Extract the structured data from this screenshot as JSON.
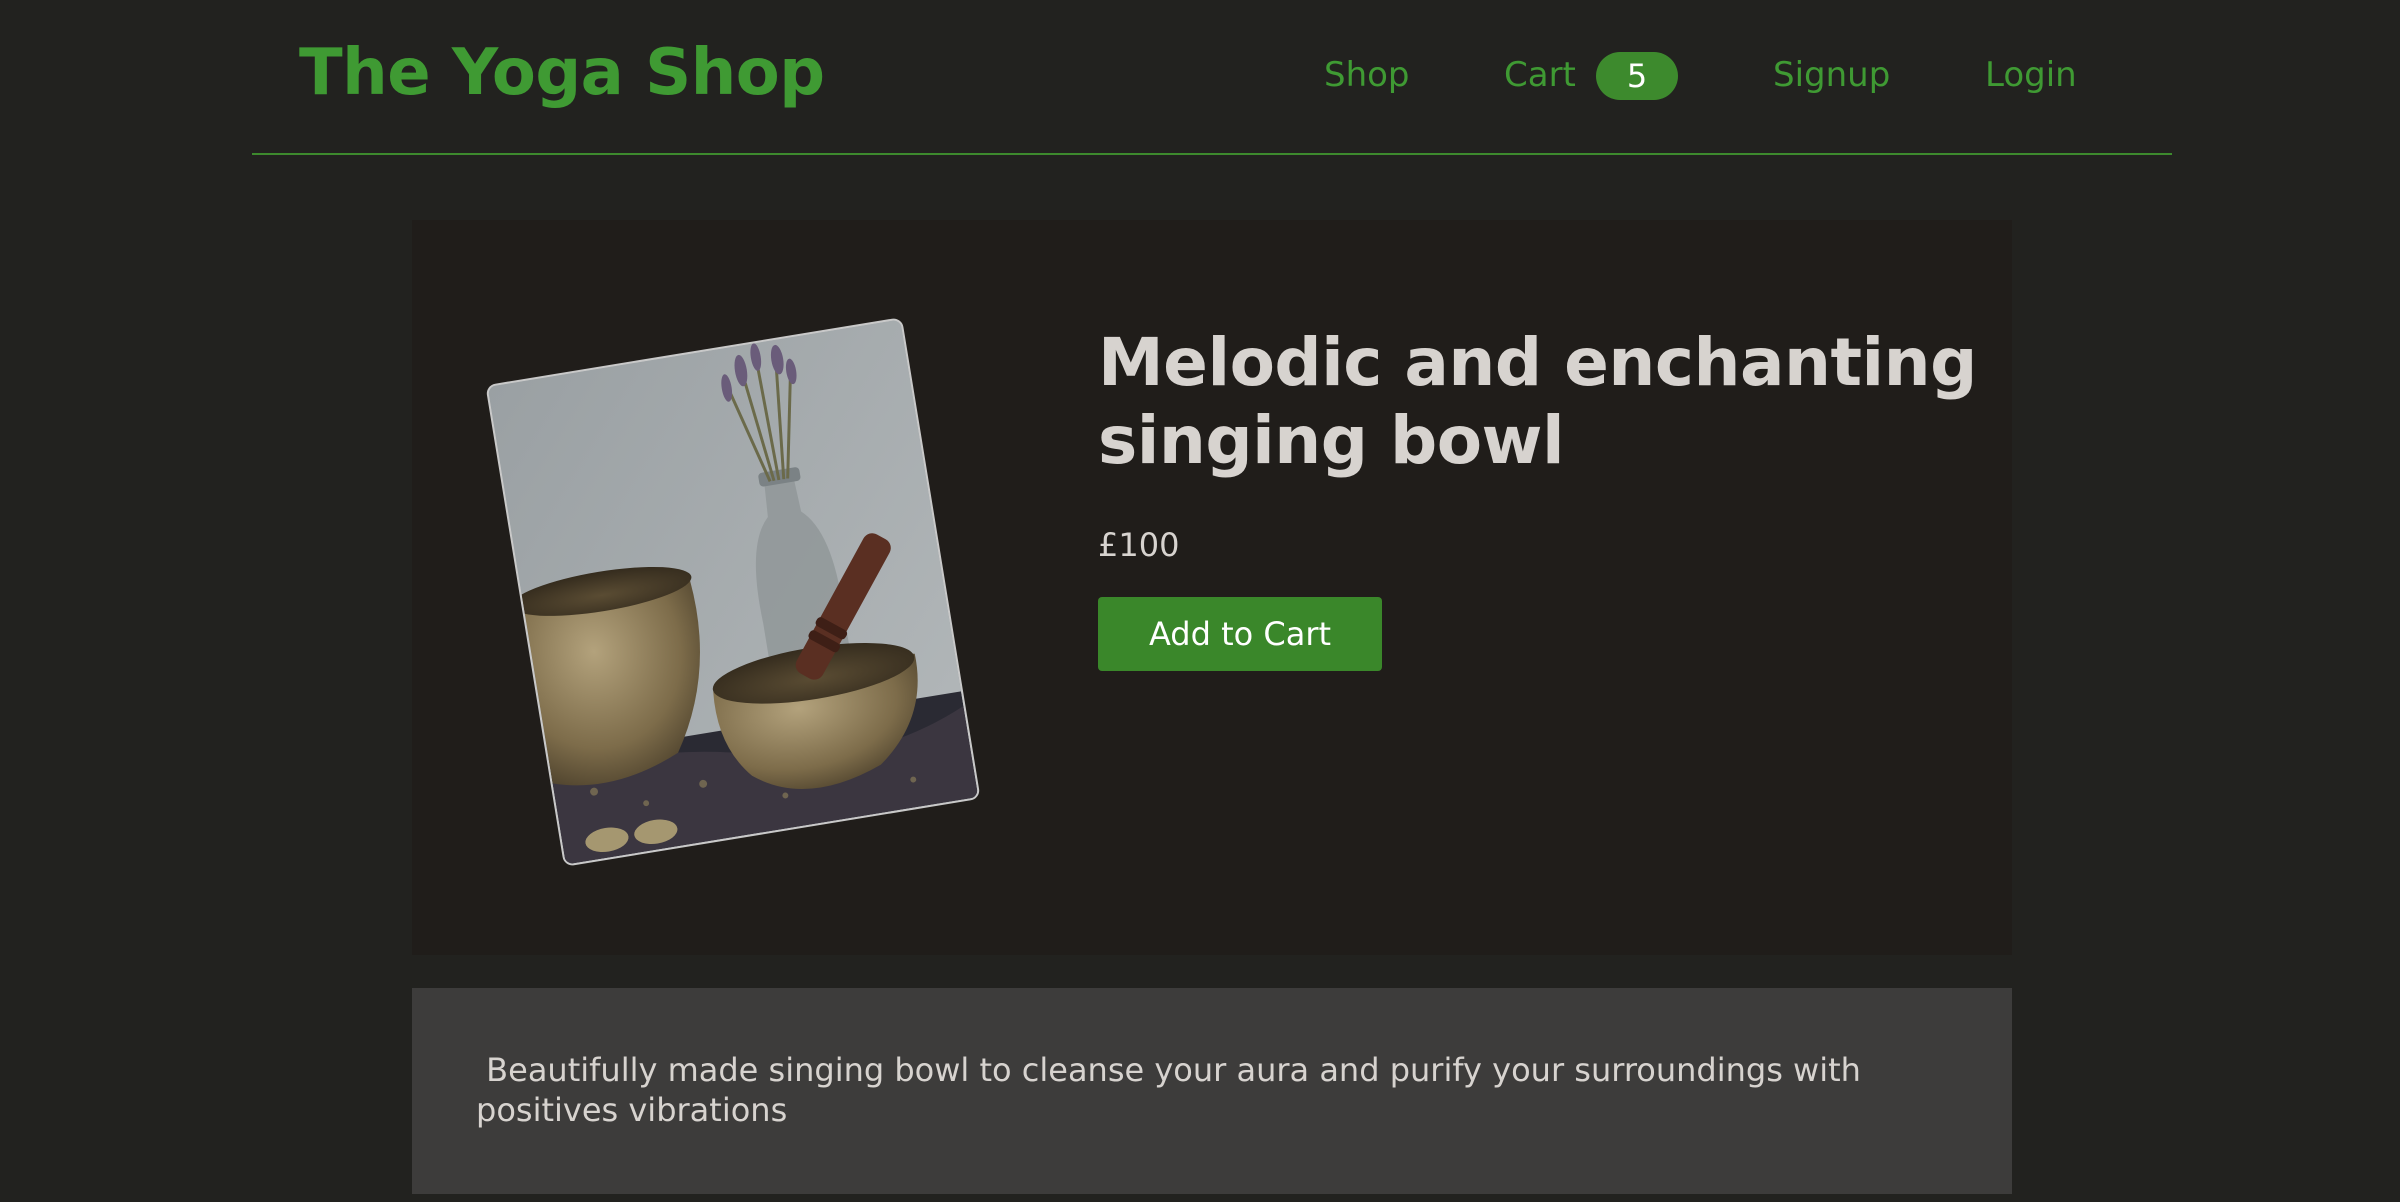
{
  "header": {
    "brand": "The Yoga Shop",
    "nav": {
      "shop": "Shop",
      "cart": "Cart",
      "cart_count": "5",
      "signup": "Signup",
      "login": "Login"
    }
  },
  "product": {
    "title": "Melodic and enchanting singing bowl",
    "price": "£100",
    "add_to_cart_label": "Add to Cart",
    "description": " Beautifully made singing bowl to cleanse your aura and purify your surroundings with positives vibrations"
  },
  "colors": {
    "background": "#22221f",
    "brand_green": "#3f9a33",
    "button_green": "#3a872a",
    "panel": "#201d1a",
    "description_panel": "#3d3c3b",
    "text_light": "#d7d3cf"
  }
}
